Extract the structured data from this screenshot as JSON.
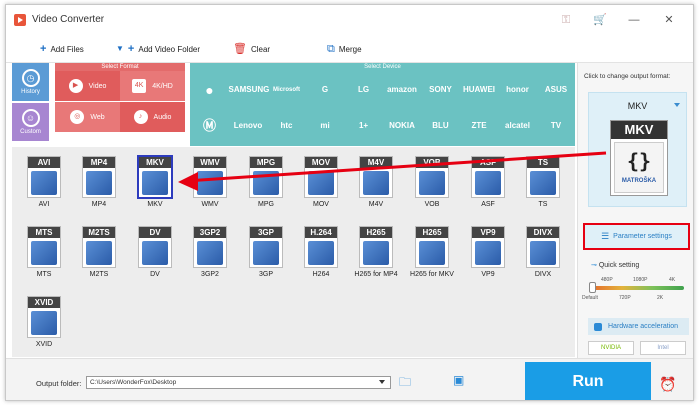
{
  "window": {
    "title": "Video Converter"
  },
  "toolbar": {
    "add_files": "Add Files",
    "add_video_folder": "Add Video Folder",
    "clear": "Clear",
    "merge": "Merge"
  },
  "sections": {
    "select_format": "Select Format",
    "select_device": "Select Device"
  },
  "side_tabs": [
    {
      "label": "History"
    },
    {
      "label": "Custom"
    }
  ],
  "format_categories": [
    {
      "label": "Video"
    },
    {
      "label": "4K/HD"
    },
    {
      "label": "Web"
    },
    {
      "label": "Audio"
    }
  ],
  "devices_row1": [
    "",
    "SAMSUNG",
    "Microsoft",
    "G",
    "LG",
    "amazon",
    "SONY",
    "HUAWEI",
    "honor",
    "ASUS"
  ],
  "devices_row2": [
    "",
    "Lenovo",
    "htc",
    "mi",
    "1+",
    "NOKIA",
    "BLU",
    "ZTE",
    "alcatel",
    "TV"
  ],
  "formats": [
    {
      "label": "AVI",
      "caption": "AVI"
    },
    {
      "label": "MP4",
      "caption": "MP4"
    },
    {
      "label": "MKV",
      "caption": "MKV"
    },
    {
      "label": "WMV",
      "caption": "WMV"
    },
    {
      "label": "MPG",
      "caption": "MPG"
    },
    {
      "label": "MOV",
      "caption": "MOV"
    },
    {
      "label": "M4V",
      "caption": "M4V"
    },
    {
      "label": "VOB",
      "caption": "VOB"
    },
    {
      "label": "ASF",
      "caption": "ASF"
    },
    {
      "label": "TS",
      "caption": "TS"
    },
    {
      "label": "MTS",
      "caption": "MTS"
    },
    {
      "label": "M2TS",
      "caption": "M2TS"
    },
    {
      "label": "DV",
      "caption": "DV"
    },
    {
      "label": "3GP2",
      "caption": "3GP2"
    },
    {
      "label": "3GP",
      "caption": "3GP"
    },
    {
      "label": "H.264",
      "caption": "H264"
    },
    {
      "label": "H265",
      "caption": "H265 for MP4"
    },
    {
      "label": "H265",
      "caption": "H265 for MKV"
    },
    {
      "label": "VP9",
      "caption": "VP9"
    },
    {
      "label": "DIVX",
      "caption": "DIVX"
    },
    {
      "label": "XVID",
      "caption": "XVID"
    }
  ],
  "right_panel": {
    "caption": "Click to change output format:",
    "format_name": "MKV",
    "icon_label": "MKV",
    "icon_sub": "MATROŠKA",
    "parameter_settings": "Parameter settings",
    "quick_setting": "Quick setting",
    "ticks_top": [
      "480P",
      "1080P",
      "4K"
    ],
    "ticks_bottom": [
      "Default",
      "720P",
      "2K"
    ],
    "hardware_acceleration": "Hardware acceleration",
    "chips": [
      "NVIDIA",
      "Intel"
    ]
  },
  "bottom": {
    "output_folder_label": "Output folder:",
    "output_folder_value": "C:\\Users\\WonderFox\\Desktop",
    "run": "Run"
  }
}
